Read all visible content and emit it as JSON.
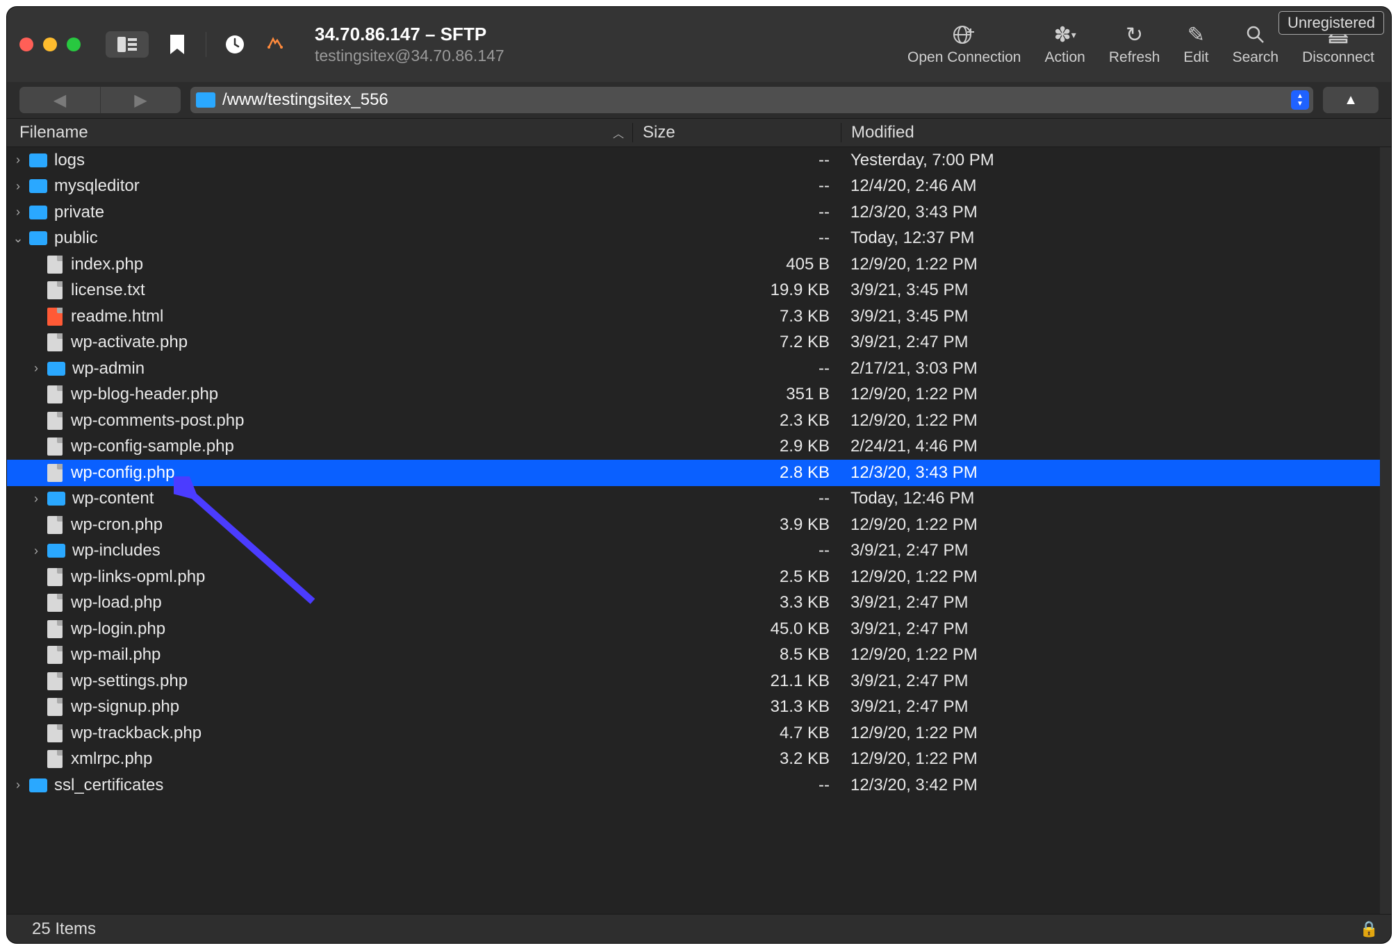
{
  "window": {
    "title": "34.70.86.147 – SFTP",
    "subtitle": "testingsitex@34.70.86.147",
    "unregistered": "Unregistered"
  },
  "toolbar": {
    "open_connection": "Open Connection",
    "action": "Action",
    "refresh": "Refresh",
    "edit": "Edit",
    "search": "Search",
    "disconnect": "Disconnect"
  },
  "path": "/www/testingsitex_556",
  "columns": {
    "filename": "Filename",
    "size": "Size",
    "modified": "Modified"
  },
  "files": [
    {
      "name": "logs",
      "type": "folder",
      "depth": 0,
      "size": "--",
      "modified": "Yesterday, 7:00 PM",
      "disclosure": "closed"
    },
    {
      "name": "mysqleditor",
      "type": "folder",
      "depth": 0,
      "size": "--",
      "modified": "12/4/20, 2:46 AM",
      "disclosure": "closed"
    },
    {
      "name": "private",
      "type": "folder",
      "depth": 0,
      "size": "--",
      "modified": "12/3/20, 3:43 PM",
      "disclosure": "closed"
    },
    {
      "name": "public",
      "type": "folder",
      "depth": 0,
      "size": "--",
      "modified": "Today, 12:37 PM",
      "disclosure": "open"
    },
    {
      "name": "index.php",
      "type": "file",
      "depth": 1,
      "size": "405 B",
      "modified": "12/9/20, 1:22 PM"
    },
    {
      "name": "license.txt",
      "type": "file",
      "depth": 1,
      "size": "19.9 KB",
      "modified": "3/9/21, 3:45 PM"
    },
    {
      "name": "readme.html",
      "type": "html",
      "depth": 1,
      "size": "7.3 KB",
      "modified": "3/9/21, 3:45 PM"
    },
    {
      "name": "wp-activate.php",
      "type": "file",
      "depth": 1,
      "size": "7.2 KB",
      "modified": "3/9/21, 2:47 PM"
    },
    {
      "name": "wp-admin",
      "type": "folder",
      "depth": 1,
      "size": "--",
      "modified": "2/17/21, 3:03 PM",
      "disclosure": "closed"
    },
    {
      "name": "wp-blog-header.php",
      "type": "file",
      "depth": 1,
      "size": "351 B",
      "modified": "12/9/20, 1:22 PM"
    },
    {
      "name": "wp-comments-post.php",
      "type": "file",
      "depth": 1,
      "size": "2.3 KB",
      "modified": "12/9/20, 1:22 PM"
    },
    {
      "name": "wp-config-sample.php",
      "type": "file",
      "depth": 1,
      "size": "2.9 KB",
      "modified": "2/24/21, 4:46 PM"
    },
    {
      "name": "wp-config.php",
      "type": "file",
      "depth": 1,
      "size": "2.8 KB",
      "modified": "12/3/20, 3:43 PM",
      "selected": true
    },
    {
      "name": "wp-content",
      "type": "folder",
      "depth": 1,
      "size": "--",
      "modified": "Today, 12:46 PM",
      "disclosure": "closed"
    },
    {
      "name": "wp-cron.php",
      "type": "file",
      "depth": 1,
      "size": "3.9 KB",
      "modified": "12/9/20, 1:22 PM"
    },
    {
      "name": "wp-includes",
      "type": "folder",
      "depth": 1,
      "size": "--",
      "modified": "3/9/21, 2:47 PM",
      "disclosure": "closed"
    },
    {
      "name": "wp-links-opml.php",
      "type": "file",
      "depth": 1,
      "size": "2.5 KB",
      "modified": "12/9/20, 1:22 PM"
    },
    {
      "name": "wp-load.php",
      "type": "file",
      "depth": 1,
      "size": "3.3 KB",
      "modified": "3/9/21, 2:47 PM"
    },
    {
      "name": "wp-login.php",
      "type": "file",
      "depth": 1,
      "size": "45.0 KB",
      "modified": "3/9/21, 2:47 PM"
    },
    {
      "name": "wp-mail.php",
      "type": "file",
      "depth": 1,
      "size": "8.5 KB",
      "modified": "12/9/20, 1:22 PM"
    },
    {
      "name": "wp-settings.php",
      "type": "file",
      "depth": 1,
      "size": "21.1 KB",
      "modified": "3/9/21, 2:47 PM"
    },
    {
      "name": "wp-signup.php",
      "type": "file",
      "depth": 1,
      "size": "31.3 KB",
      "modified": "3/9/21, 2:47 PM"
    },
    {
      "name": "wp-trackback.php",
      "type": "file",
      "depth": 1,
      "size": "4.7 KB",
      "modified": "12/9/20, 1:22 PM"
    },
    {
      "name": "xmlrpc.php",
      "type": "file",
      "depth": 1,
      "size": "3.2 KB",
      "modified": "12/9/20, 1:22 PM"
    },
    {
      "name": "ssl_certificates",
      "type": "folder",
      "depth": 0,
      "size": "--",
      "modified": "12/3/20, 3:42 PM",
      "disclosure": "closed"
    }
  ],
  "status": "25 Items"
}
